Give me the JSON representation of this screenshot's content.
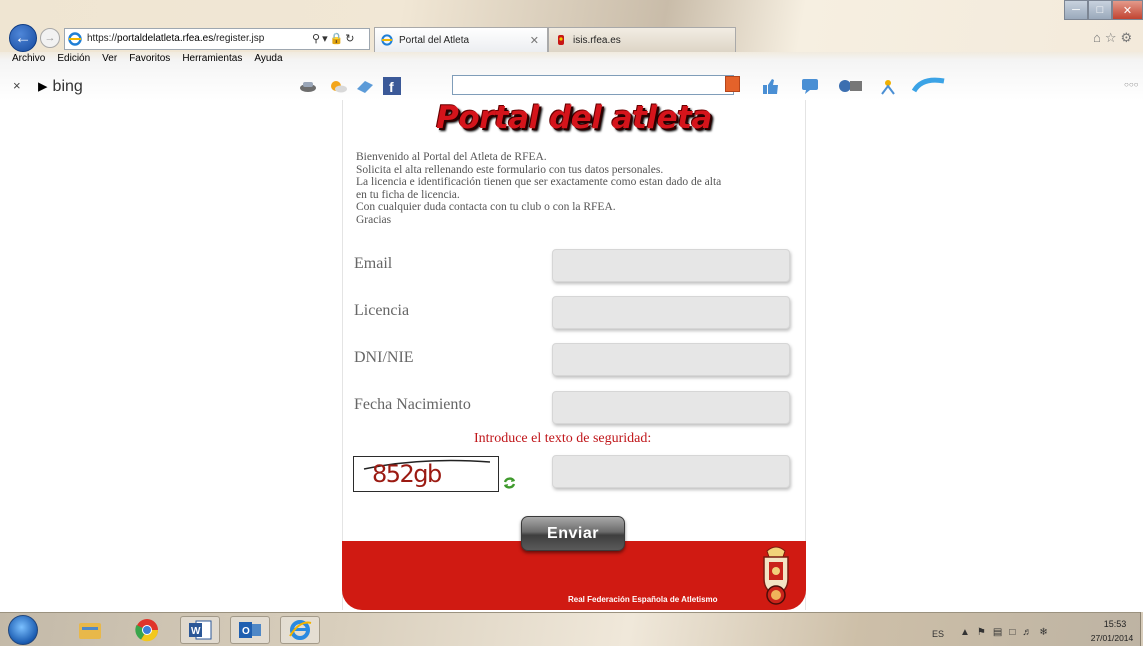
{
  "browser": {
    "url": "https://portaldelatleta.rfea.es/register.jsp",
    "url_display_scheme": "https://",
    "url_display_host": "portaldelatleta.rfea.es",
    "url_display_path": "/register.jsp",
    "tabs": [
      {
        "label": "Portal del Atleta",
        "active": true
      },
      {
        "label": "isis.rfea.es",
        "active": false
      }
    ],
    "menu": [
      "Archivo",
      "Edición",
      "Ver",
      "Favoritos",
      "Herramientas",
      "Ayuda"
    ],
    "bing_label": "bing",
    "bing_search_value": ""
  },
  "page": {
    "title": "Portal del atleta",
    "intro_lines": [
      "Bienvenido al Portal del Atleta de RFEA.",
      "Solicita el alta rellenando este formulario con tus datos personales.",
      "La licencia e identificación tienen que ser exactamente como estan dado de alta",
      "en tu ficha de licencia.",
      "Con cualquier duda contacta con tu club o con la RFEA.",
      "Gracias"
    ],
    "fields": {
      "email_label": "Email",
      "email_value": "",
      "licencia_label": "Licencia",
      "licencia_value": "",
      "dni_label": "DNI/NIE",
      "dni_value": "",
      "fecha_label": "Fecha Nacimiento",
      "fecha_value": ""
    },
    "captcha": {
      "prompt": "Introduce el texto de seguridad:",
      "image_text": "852gb",
      "input_value": ""
    },
    "submit_label": "Enviar",
    "footer_text": "Real Federación Española de Atletismo"
  },
  "taskbar": {
    "apps": [
      "start-orb",
      "file-explorer",
      "chrome",
      "word",
      "outlook",
      "internet-explorer"
    ],
    "language": "ES",
    "time": "15:53",
    "date": "27/01/2014"
  },
  "colors": {
    "brand_red": "#d01a12",
    "title_red": "#d5141b",
    "captcha_prompt_red": "#c0161a"
  }
}
